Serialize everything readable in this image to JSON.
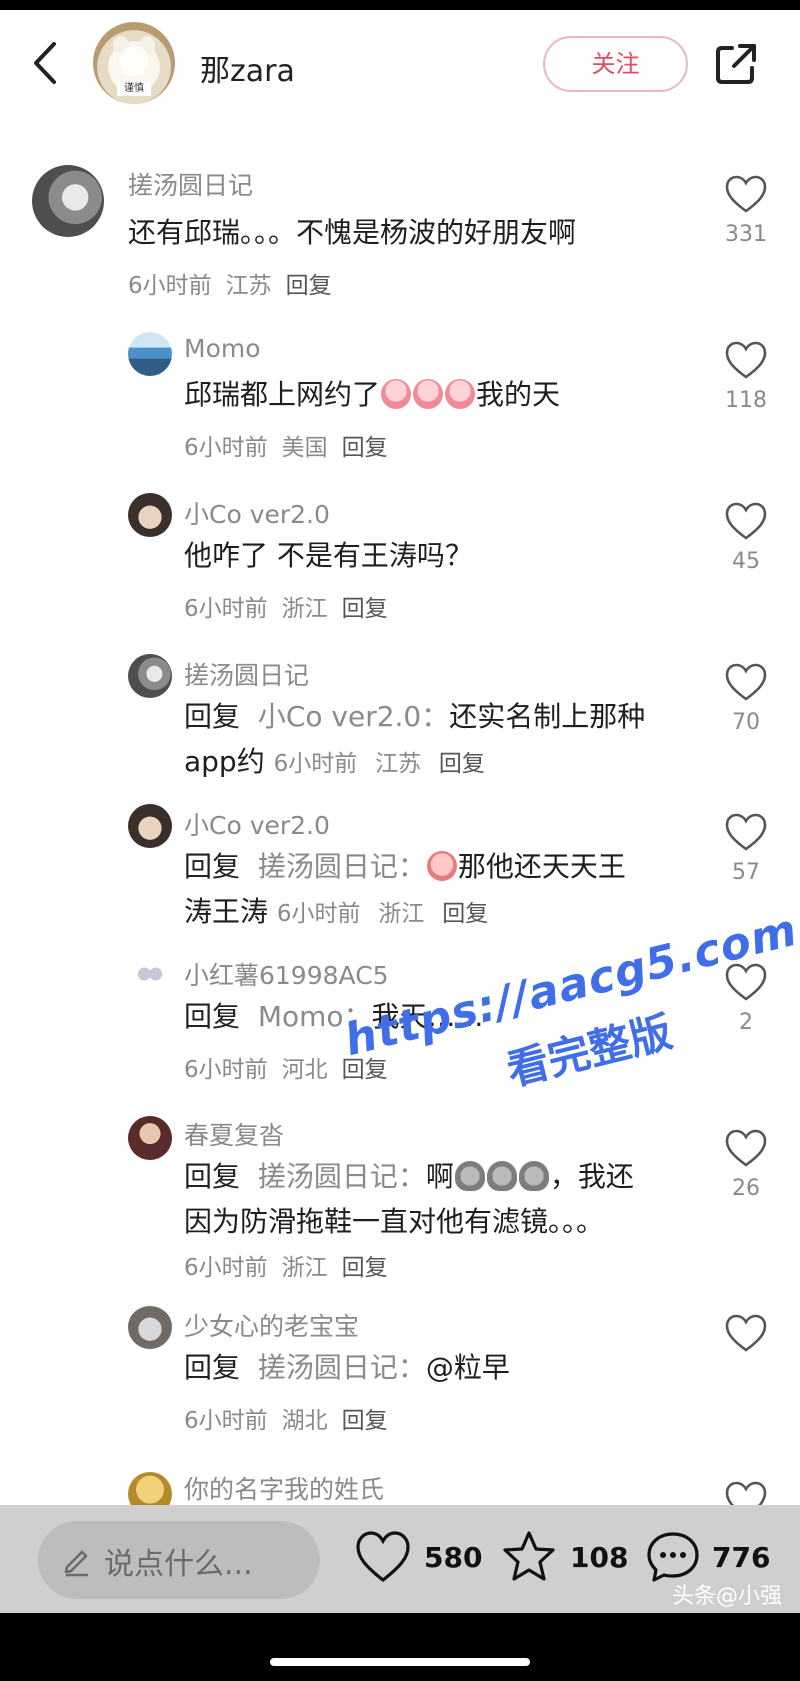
{
  "header": {
    "back_icon": "chevron-left-icon",
    "author_name": "那zara",
    "avatar_stamp": "谨慎",
    "follow_label": "关注",
    "share_icon": "share-external-icon"
  },
  "comments": [
    {
      "user": "搓汤圆日记",
      "text": "还有邱瑞。。。不愧是杨波的好朋友啊",
      "time": "6小时前",
      "location": "江苏",
      "reply_label": "回复",
      "likes": "331"
    },
    {
      "user": "Momo",
      "text_before": "邱瑞都上网约了",
      "text_after": "我的天",
      "time": "6小时前",
      "location": "美国",
      "reply_label": "回复",
      "likes": "118"
    },
    {
      "user": "小Co ver2.0",
      "text": "他咋了 不是有王涛吗？",
      "time": "6小时前",
      "location": "浙江",
      "reply_label": "回复",
      "likes": "45"
    },
    {
      "user": "搓汤圆日记",
      "reply_kw": "回复",
      "reply_target": "小Co ver2.0：",
      "text_line1": "还实名制上那种",
      "text_line2": "app约",
      "time": "6小时前",
      "location": "江苏",
      "reply_label": "回复",
      "likes": "70"
    },
    {
      "user": "小Co ver2.0",
      "reply_kw": "回复",
      "reply_target": "搓汤圆日记：",
      "text_line1": "那他还天天王",
      "text_line2": "涛王涛",
      "time": "6小时前",
      "location": "浙江",
      "reply_label": "回复",
      "likes": "57"
    },
    {
      "user": "小红薯61998AC5",
      "reply_kw": "回复",
      "reply_target": "Momo：",
      "text": "我天……",
      "time": "6小时前",
      "location": "河北",
      "reply_label": "回复",
      "likes": "2"
    },
    {
      "user": "春夏复沓",
      "reply_kw": "回复",
      "reply_target": "搓汤圆日记：",
      "text_line1_a": "啊",
      "text_line1_b": "，我还",
      "text_line2": "因为防滑拖鞋一直对他有滤镜。。。",
      "time": "6小时前",
      "location": "浙江",
      "reply_label": "回复",
      "likes": "26"
    },
    {
      "user": "少女心的老宝宝",
      "reply_kw": "回复",
      "reply_target": "搓汤圆日记：",
      "text": "@粒早",
      "time": "6小时前",
      "location": "湖北",
      "reply_label": "回复",
      "likes": ""
    },
    {
      "user": "你的名字我的姓氏"
    }
  ],
  "watermark": {
    "url": "https://aacg5.com",
    "caption": "看完整版"
  },
  "bottom_bar": {
    "input_placeholder": "说点什么...",
    "likes": "580",
    "stars": "108",
    "comments": "776",
    "source_tag": "头条@小强"
  }
}
